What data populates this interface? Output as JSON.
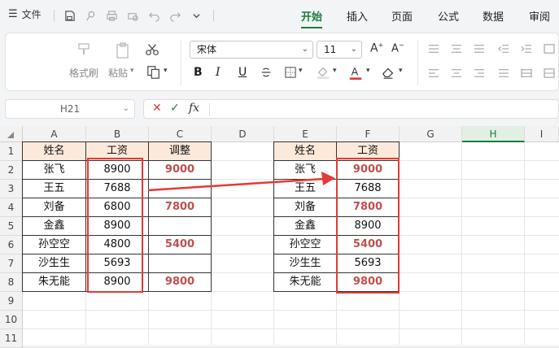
{
  "menu": {
    "file_label": "文件",
    "tabs": [
      "开始",
      "插入",
      "页面",
      "公式",
      "数据",
      "审阅"
    ]
  },
  "ribbon": {
    "format_painter": "格式刷",
    "paste": "粘贴",
    "font_name": "宋体",
    "font_size": "11"
  },
  "formula_bar": {
    "cell_ref": "H21",
    "fx": "fx"
  },
  "columns": [
    "A",
    "B",
    "C",
    "D",
    "E",
    "F",
    "G",
    "H",
    "I"
  ],
  "rows": [
    "1",
    "2",
    "3",
    "4",
    "5",
    "6",
    "7",
    "8",
    "9",
    "10",
    "11"
  ],
  "left_table": {
    "headers": [
      "姓名",
      "工资",
      "调整"
    ],
    "rows": [
      [
        "张飞",
        "8900",
        "9000"
      ],
      [
        "王五",
        "7688",
        ""
      ],
      [
        "刘备",
        "6800",
        "7800"
      ],
      [
        "金鑫",
        "8900",
        ""
      ],
      [
        "孙空空",
        "4800",
        "5400"
      ],
      [
        "沙生生",
        "5693",
        ""
      ],
      [
        "朱无能",
        "8900",
        "9800"
      ]
    ]
  },
  "right_table": {
    "headers": [
      "姓名",
      "工资"
    ],
    "rows": [
      [
        "张飞",
        "9000"
      ],
      [
        "王五",
        "7688"
      ],
      [
        "刘备",
        "7800"
      ],
      [
        "金鑫",
        "8900"
      ],
      [
        "孙空空",
        "5400"
      ],
      [
        "沙生生",
        "5693"
      ],
      [
        "朱无能",
        "9800"
      ]
    ],
    "adjusted_flags": [
      true,
      false,
      true,
      false,
      true,
      false,
      true
    ]
  },
  "colors": {
    "accent": "#1a7f37",
    "header_fill": "#fde9d9",
    "highlight_text": "#c0504d",
    "annotation": "#e53935"
  }
}
